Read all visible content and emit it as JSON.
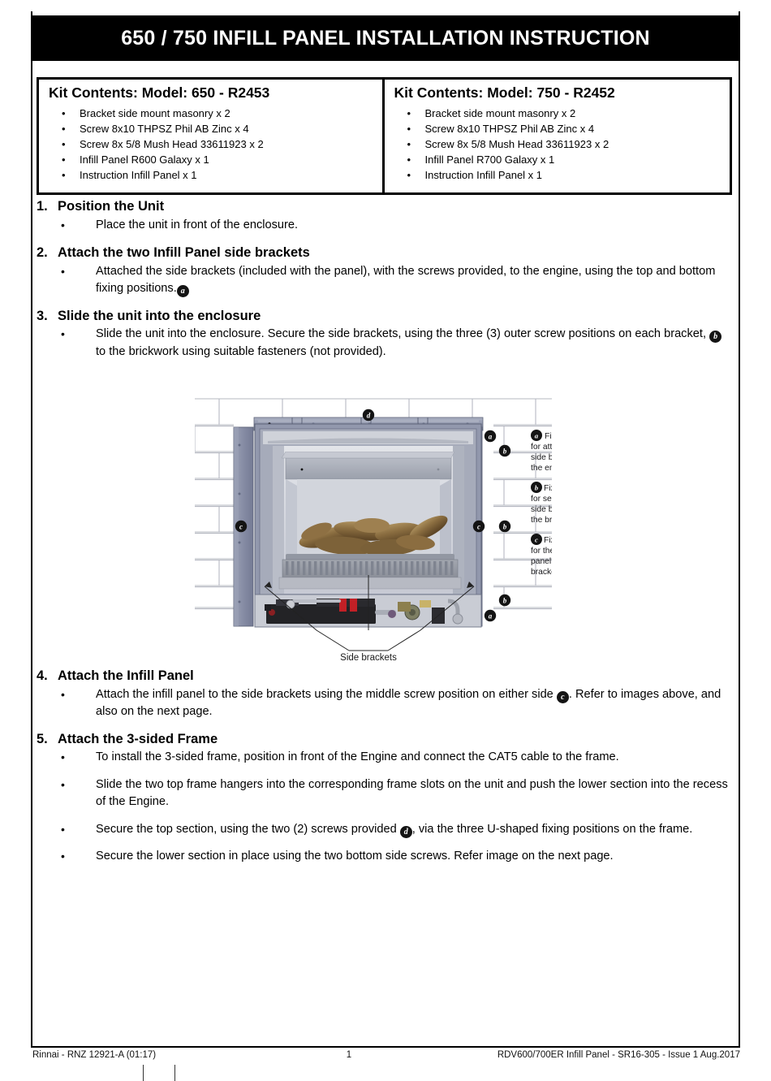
{
  "document": {
    "title": "650 / 750 INFILL PANEL INSTALLATION INSTRUCTION"
  },
  "kit_contents": {
    "columns": [
      {
        "heading": "Kit Contents: Model: 650 - R2453",
        "bullet": "•",
        "items": [
          "Bracket side mount masonry x 2",
          "Screw 8x10 THPSZ Phil AB Zinc x 4",
          "Screw 8x 5/8 Mush Head 33611923 x 2",
          "Infill Panel R600 Galaxy x 1",
          "Instruction Infill Panel x 1"
        ]
      },
      {
        "heading": "Kit Contents: Model: 750 - R2452",
        "bullet": "•",
        "items": [
          "Bracket side mount masonry x 2",
          "Screw 8x10 THPSZ Phil AB Zinc x 4",
          "Screw 8x 5/8 Mush Head 33611923 x 2",
          "Infill Panel R700 Galaxy x 1",
          "Instruction Infill Panel x 1"
        ]
      }
    ]
  },
  "steps": [
    {
      "number": "1.",
      "title": "Position the Unit",
      "bullets": [
        {
          "pre": "Place the unit in front of the enclosure.",
          "badge": "",
          "post": ""
        }
      ]
    },
    {
      "number": "2.",
      "title": "Attach the two Infill Panel side brackets",
      "bullets": [
        {
          "pre": "Attached the side brackets (included with the panel), with the screws provided, to the engine, using the top and bottom fixing positions.",
          "badge": "a",
          "post": ""
        }
      ]
    },
    {
      "number": "3.",
      "title": "Slide the unit into the enclosure",
      "bullets": [
        {
          "pre": "Slide the unit into the enclosure. Secure the side brackets, using the three (3) outer screw positions on each bracket,",
          "badge": "b",
          "post": "to the brickwork using suitable fasteners (not provided)."
        }
      ]
    },
    {
      "number": "4.",
      "title": "Attach the Infill Panel",
      "bullets": [
        {
          "pre": "Attach the infill panel to the side brackets using the middle screw position on either side",
          "badge": "c",
          "post": ". Refer to images above, and also on the next page."
        }
      ]
    },
    {
      "number": "5.",
      "title": "Attach the 3-sided Frame",
      "bullets": [
        {
          "pre": "To install the 3-sided frame, position in front of the Engine and connect the CAT5 cable to the frame.",
          "badge": "",
          "post": ""
        },
        {
          "pre": "Slide the two top frame hangers into the corresponding frame slots on the unit and push the lower section into the recess of the Engine.",
          "badge": "",
          "post": ""
        },
        {
          "pre": "Secure the top section, using the two (2) screws provided",
          "badge": "d",
          "post": ", via the three U-shaped fixing positions on the frame."
        },
        {
          "pre": "Secure the lower section in place using the two bottom side screws. Refer image on the next page.",
          "badge": "",
          "post": ""
        }
      ]
    }
  ],
  "figure": {
    "caption": "Side brackets",
    "markers_on_drawing": [
      "d",
      "a",
      "b",
      "c",
      "c",
      "b",
      "b",
      "a"
    ],
    "legend": [
      {
        "key": "a",
        "text": "Fixing positions for attaching the side brackets to the engine."
      },
      {
        "key": "b",
        "text": "Fixing positions for securing the side brackets to the brickwork."
      },
      {
        "key": "c",
        "text": "Fixing position for the infill panel to the side brackets."
      }
    ]
  },
  "footer": {
    "left": "Rinnai - RNZ 12921-A (01:17)",
    "center": "1",
    "right": "RDV600/700ER Infill Panel - SR16-305 - Issue 1 Aug.2017"
  },
  "colors": {
    "title_bar_bg": "#000000",
    "title_bar_fg": "#ffffff",
    "badge_bg": "#141414",
    "metal_frame": "#8c91a8",
    "metal_frame_dark": "#6f7690",
    "interior_light": "#d5d7de",
    "interior_mid": "#c3c6d0",
    "log_brown": "#8a6a3d",
    "brick_line": "#b9bcc4"
  }
}
